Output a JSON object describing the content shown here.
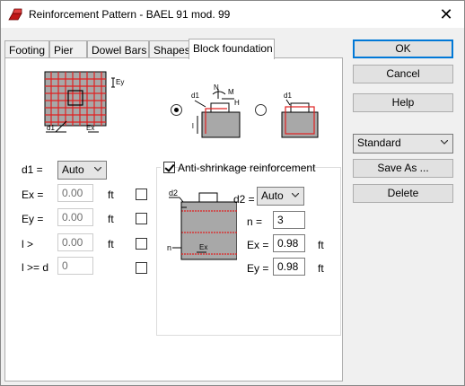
{
  "window": {
    "title": "Reinforcement Pattern - BAEL 91 mod. 99",
    "close_glyph": "✕"
  },
  "tabs": [
    {
      "label": "Footing",
      "active": false
    },
    {
      "label": "Pier",
      "active": false
    },
    {
      "label": "Dowel Bars",
      "active": false
    },
    {
      "label": "Shapes",
      "active": false
    },
    {
      "label": "Block foundation",
      "active": true
    }
  ],
  "diagram_labels": {
    "ey": "Ey",
    "d1": "d1",
    "ex": "Ex",
    "n": "N",
    "m": "M",
    "h": "H",
    "l": "l",
    "d1_b": "d1",
    "d1_c": "d1",
    "d2": "d2",
    "n_small": "n",
    "ex_small": "Ex"
  },
  "left_params": {
    "d1_label": "d1 =",
    "d1_value": "Auto",
    "ex_label": "Ex =",
    "ex_value": "0.00",
    "ex_unit": "ft",
    "ey_label": "Ey =",
    "ey_value": "0.00",
    "ey_unit": "ft",
    "l_label": "l >",
    "l_value": "0.00",
    "l_unit": "ft",
    "ld_label": "l >= d",
    "ld_value": "0"
  },
  "anti_shrinkage": {
    "label": "Anti-shrinkage reinforcement",
    "checked": true,
    "d2_label": "d2 =",
    "d2_value": "Auto",
    "n_label": "n =",
    "n_value": "3",
    "ex_label": "Ex =",
    "ex_value": "0.98",
    "ex_unit": "ft",
    "ey_label": "Ey =",
    "ey_value": "0.98",
    "ey_unit": "ft"
  },
  "option_radio": {
    "first_selected": true
  },
  "right_buttons": {
    "ok": "OK",
    "cancel": "Cancel",
    "help": "Help",
    "standard": "Standard",
    "save_as": "Save As ...",
    "delete": "Delete"
  },
  "colors": {
    "rebar": "#e02020",
    "concrete": "#aaaaaa",
    "accent": "#0078d7"
  }
}
